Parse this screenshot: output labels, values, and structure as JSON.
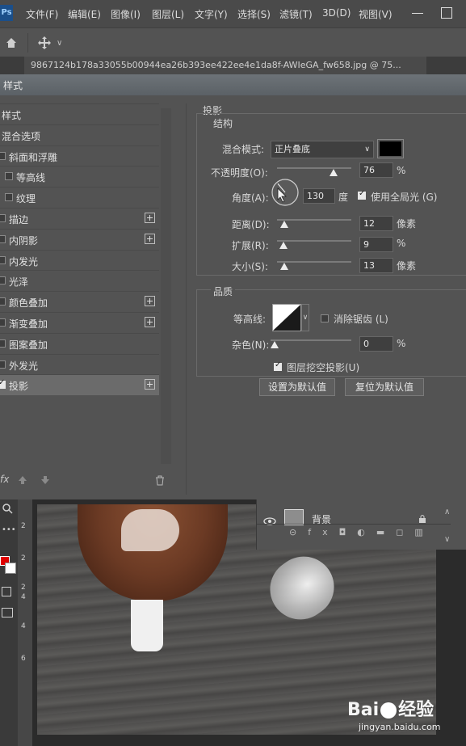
{
  "app": {
    "logo": "Ps"
  },
  "menubar": {
    "items": [
      "文件(F)",
      "编辑(E)",
      "图像(I)",
      "图层(L)",
      "文字(Y)",
      "选择(S)",
      "滤镜(T)",
      "3D(D)",
      "视图(V)"
    ]
  },
  "optionsbar": {
    "home_icon": "home-icon",
    "move_icon": "move-icon"
  },
  "document": {
    "tab_title": "9867124b178a33055b00944ea26b393ee422ee4e1da8f-AWIeGA_fw658.jpg @ 75..."
  },
  "dialog": {
    "title": "样式",
    "styles": [
      {
        "label": "样式",
        "checkbox": false,
        "checked": false,
        "plus": false,
        "selected": false
      },
      {
        "label": "混合选项",
        "checkbox": false,
        "checked": false,
        "plus": false,
        "selected": false
      },
      {
        "label": "斜面和浮雕",
        "checkbox": true,
        "checked": false,
        "plus": false,
        "selected": false
      },
      {
        "label": "等高线",
        "checkbox": true,
        "checked": false,
        "plus": false,
        "selected": false,
        "indent": true
      },
      {
        "label": "纹理",
        "checkbox": true,
        "checked": false,
        "plus": false,
        "selected": false,
        "indent": true
      },
      {
        "label": "描边",
        "checkbox": true,
        "checked": false,
        "plus": true,
        "selected": false
      },
      {
        "label": "内阴影",
        "checkbox": true,
        "checked": false,
        "plus": true,
        "selected": false
      },
      {
        "label": "内发光",
        "checkbox": true,
        "checked": false,
        "plus": false,
        "selected": false
      },
      {
        "label": "光泽",
        "checkbox": true,
        "checked": false,
        "plus": false,
        "selected": false
      },
      {
        "label": "颜色叠加",
        "checkbox": true,
        "checked": false,
        "plus": true,
        "selected": false
      },
      {
        "label": "渐变叠加",
        "checkbox": true,
        "checked": false,
        "plus": true,
        "selected": false
      },
      {
        "label": "图案叠加",
        "checkbox": true,
        "checked": false,
        "plus": false,
        "selected": false
      },
      {
        "label": "外发光",
        "checkbox": true,
        "checked": false,
        "plus": false,
        "selected": false
      },
      {
        "label": "投影",
        "checkbox": true,
        "checked": true,
        "plus": true,
        "selected": true
      }
    ],
    "footer_icons": {
      "fx": "fx",
      "up": "arrow-up-icon",
      "down": "arrow-down-icon",
      "trash": "trash-icon"
    },
    "panel": {
      "title": "投影",
      "structure_title": "结构",
      "blend_mode_label": "混合模式:",
      "blend_mode_value": "正片叠底",
      "shadow_color": "#000000",
      "opacity_label": "不透明度(O):",
      "opacity_value": "76",
      "opacity_percent": 76,
      "angle_label": "角度(A):",
      "angle_value": "130",
      "angle_unit": "度",
      "global_light_label": "使用全局光 (G)",
      "global_light_checked": true,
      "distance_label": "距离(D):",
      "distance_value": "12",
      "distance_unit": "像素",
      "spread_label": "扩展(R):",
      "spread_value": "9",
      "spread_unit": "%",
      "size_label": "大小(S):",
      "size_value": "13",
      "size_unit": "像素",
      "quality_title": "品质",
      "contour_label": "等高线:",
      "antialias_label": "消除锯齿 (L)",
      "antialias_checked": false,
      "noise_label": "杂色(N):",
      "noise_value": "0",
      "noise_unit": "%",
      "knockout_label": "图层挖空投影(U)",
      "knockout_checked": true,
      "make_default_button": "设置为默认值",
      "reset_default_button": "复位为默认值",
      "percent_sign": "%"
    }
  },
  "layers": {
    "layer_name": "背景"
  },
  "ruler_numbers": [
    "2",
    "2",
    "2",
    "4",
    "4",
    "6"
  ],
  "watermark": {
    "brand": "Bai",
    "brand2": "经验",
    "url": "jingyan.baidu.com"
  }
}
